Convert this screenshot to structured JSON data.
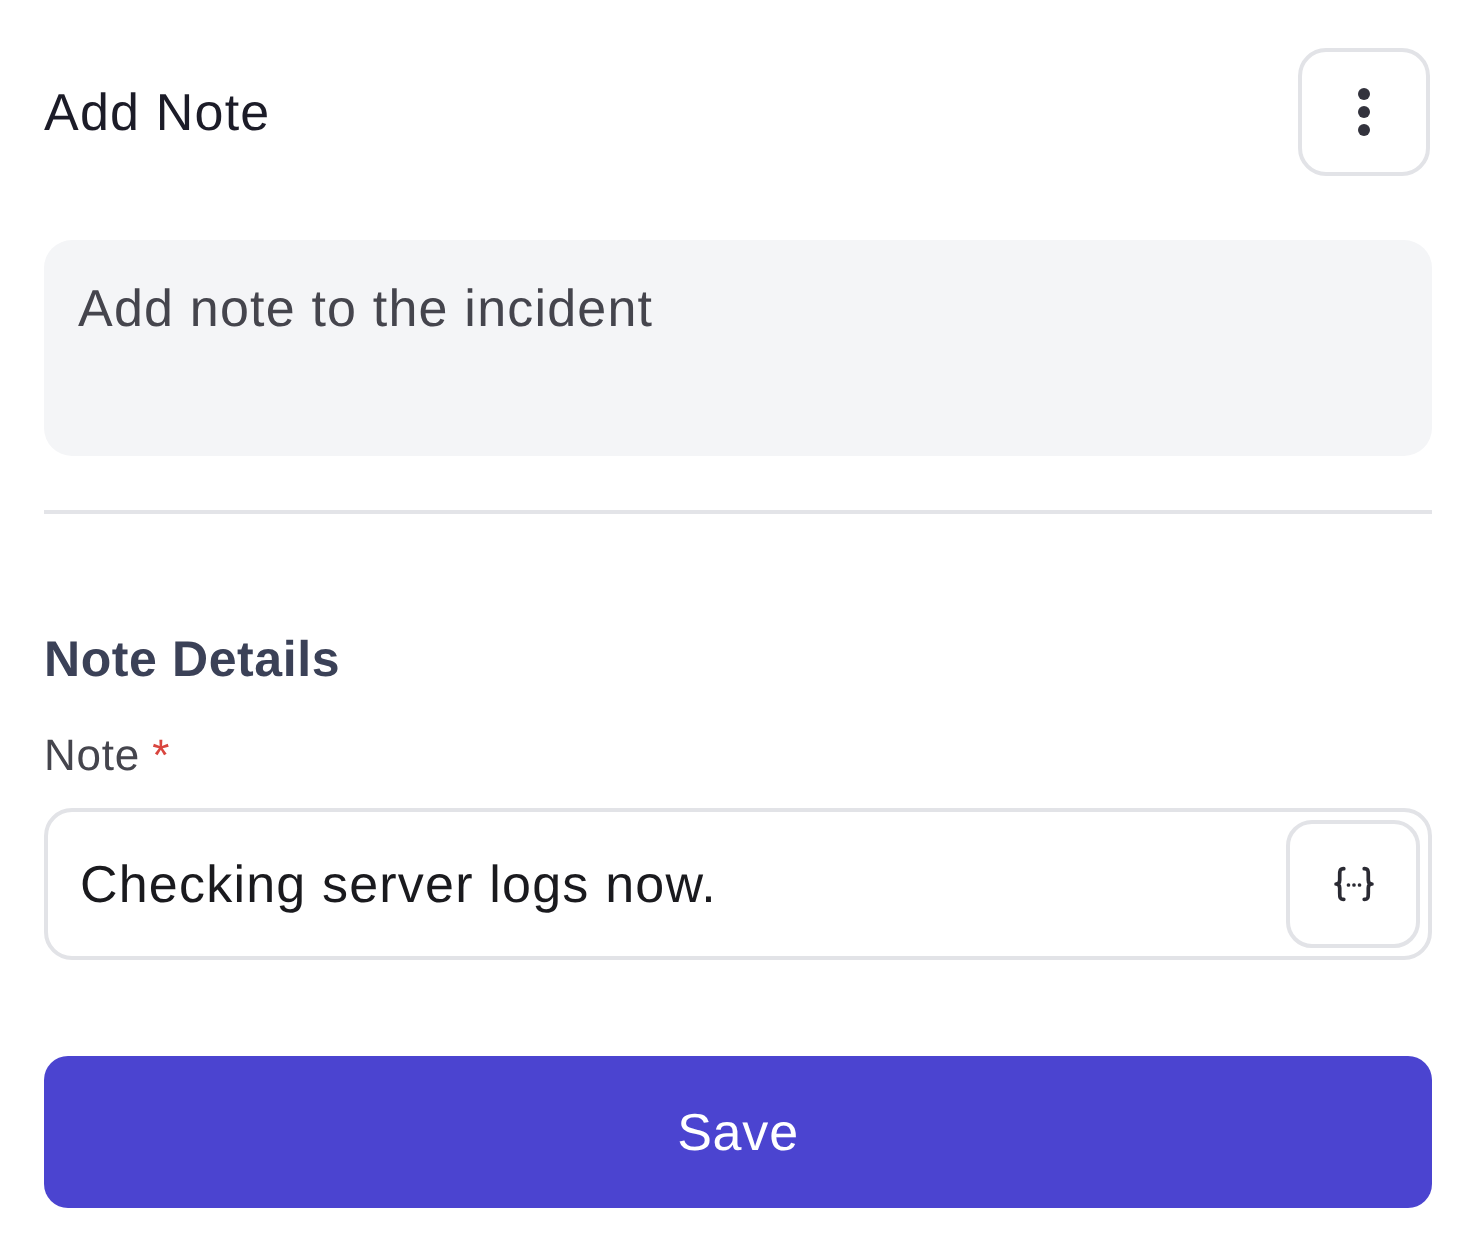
{
  "header": {
    "title": "Add Note"
  },
  "note_input": {
    "placeholder": "Add note to the incident"
  },
  "section": {
    "title": "Note Details",
    "field": {
      "label": "Note",
      "required_mark": "*",
      "value": "Checking server logs now."
    }
  },
  "buttons": [
    {
      "label": "Save",
      "kind": "primary"
    }
  ]
}
